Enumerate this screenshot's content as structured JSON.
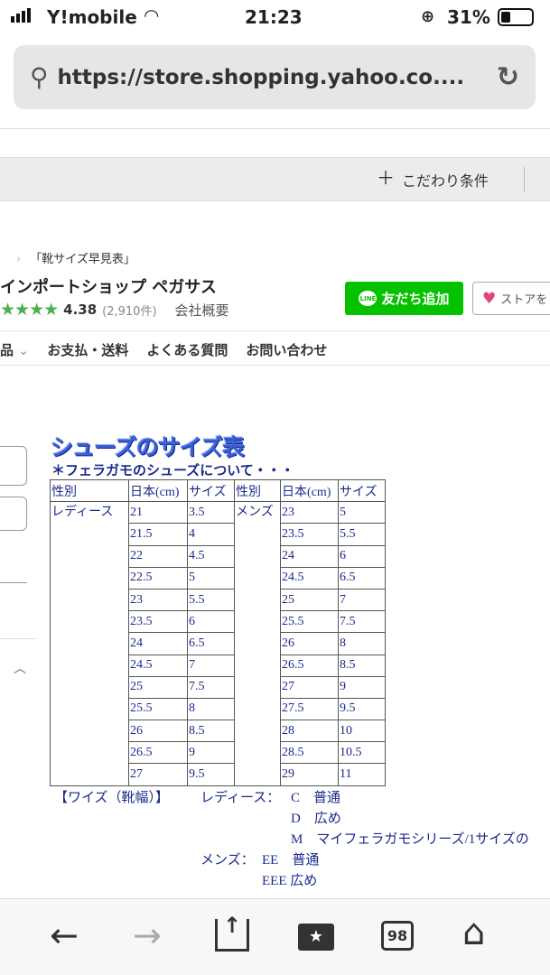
{
  "status": {
    "carrier": "Y!mobile",
    "time": "21:23",
    "battery": "31%"
  },
  "browser": {
    "url": "https://store.shopping.yahoo.co...."
  },
  "filter": {
    "label": "こだわり条件"
  },
  "store": {
    "breadcrumb": "「靴サイズ早見表」",
    "name": "インポートショップ ペガサス",
    "rating": "4.38",
    "review_count": "(2,910件)",
    "company_link": "会社概要",
    "line_button": "友だち追加",
    "line_icon_text": "LINE",
    "favorite_button": "ストアを"
  },
  "nav": {
    "items": [
      "品",
      "お支払・送料",
      "よくある質問",
      "お問い合わせ"
    ]
  },
  "size_chart": {
    "title": "シューズのサイズ表",
    "subtitle": "＊フェラガモのシューズについて・・・",
    "headers": [
      "性別",
      "日本(cm)",
      "サイズ",
      "性別",
      "日本(cm)",
      "サイズ"
    ],
    "ladies_label": "レディース",
    "mens_label": "メンズ",
    "ladies": [
      [
        "21",
        "3.5"
      ],
      [
        "21.5",
        "4"
      ],
      [
        "22",
        "4.5"
      ],
      [
        "22.5",
        "5"
      ],
      [
        "23",
        "5.5"
      ],
      [
        "23.5",
        "6"
      ],
      [
        "24",
        "6.5"
      ],
      [
        "24.5",
        "7"
      ],
      [
        "25",
        "7.5"
      ],
      [
        "25.5",
        "8"
      ],
      [
        "26",
        "8.5"
      ],
      [
        "26.5",
        "9"
      ],
      [
        "27",
        "9.5"
      ]
    ],
    "mens": [
      [
        "23",
        "5"
      ],
      [
        "23.5",
        "5.5"
      ],
      [
        "24",
        "6"
      ],
      [
        "24.5",
        "6.5"
      ],
      [
        "25",
        "7"
      ],
      [
        "25.5",
        "7.5"
      ],
      [
        "26",
        "8"
      ],
      [
        "26.5",
        "8.5"
      ],
      [
        "27",
        "9"
      ],
      [
        "27.5",
        "9.5"
      ],
      [
        "28",
        "10"
      ],
      [
        "28.5",
        "10.5"
      ],
      [
        "29",
        "11"
      ]
    ],
    "width_heading": "【ワイズ（靴幅）】",
    "ladies_width_label": "レディース：",
    "ladies_widths": [
      "C　普通",
      "D　広め",
      "M　マイフェラガモシリーズ/1サイズの"
    ],
    "mens_width_label": "メンズ：",
    "mens_widths": [
      "EE　普通",
      "EEE 広め"
    ]
  },
  "toolbar": {
    "tabs_count": "98"
  }
}
